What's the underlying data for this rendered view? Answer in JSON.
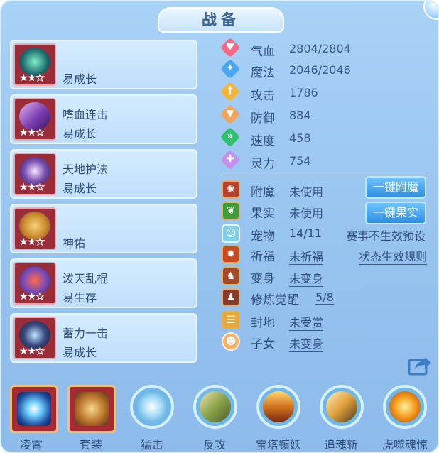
{
  "title": "战备",
  "skills": [
    {
      "name": "",
      "attr": "易成长"
    },
    {
      "name": "嗜血连击",
      "attr": "易成长"
    },
    {
      "name": "天地护法",
      "attr": "易成长"
    },
    {
      "name": "",
      "attr": "神佑"
    },
    {
      "name": "泼天乱棍",
      "attr": "易生存"
    },
    {
      "name": "蓄力一击",
      "attr": "易成长"
    }
  ],
  "star_rating": {
    "filled": 2,
    "total": 3
  },
  "stats": [
    {
      "label": "气血",
      "value": "2804/2804",
      "icon": "heart-icon",
      "color": "#f26a86"
    },
    {
      "label": "魔法",
      "value": "2046/2046",
      "icon": "mana-icon",
      "color": "#4aa6f0"
    },
    {
      "label": "攻击",
      "value": "1786",
      "icon": "sword-icon",
      "color": "#f5b53b"
    },
    {
      "label": "防御",
      "value": "884",
      "icon": "shield-icon",
      "color": "#f3a35a"
    },
    {
      "label": "速度",
      "value": "458",
      "icon": "speed-icon",
      "color": "#2fc06d"
    },
    {
      "label": "灵力",
      "value": "754",
      "icon": "spirit-icon",
      "color": "#c490ec"
    }
  ],
  "extras": [
    {
      "label": "附魔",
      "value": "未使用"
    },
    {
      "label": "果实",
      "value": "未使用"
    },
    {
      "label": "宠物",
      "value": "14/11"
    },
    {
      "label": "祈福",
      "value": "未祈福"
    },
    {
      "label": "变身",
      "value": "未变身"
    },
    {
      "label": "修炼觉醒",
      "value": "5/8"
    },
    {
      "label": "封地",
      "value": "未受赏"
    },
    {
      "label": "子女",
      "value": "未变身"
    }
  ],
  "buttons": {
    "enchant": "一键附魔",
    "fruit": "一键果实"
  },
  "links": {
    "event_preset": "赛事不生效预设",
    "status_rules": "状态生效规则"
  },
  "bottom": [
    {
      "label": "凌霄",
      "kind": "equip"
    },
    {
      "label": "套装",
      "kind": "equip"
    },
    {
      "label": "猛击",
      "kind": "skill"
    },
    {
      "label": "反攻",
      "kind": "skill"
    },
    {
      "label": "宝塔镇妖",
      "kind": "skill"
    },
    {
      "label": "追魂斩",
      "kind": "skill"
    },
    {
      "label": "虎噬魂惊",
      "kind": "skill"
    }
  ]
}
